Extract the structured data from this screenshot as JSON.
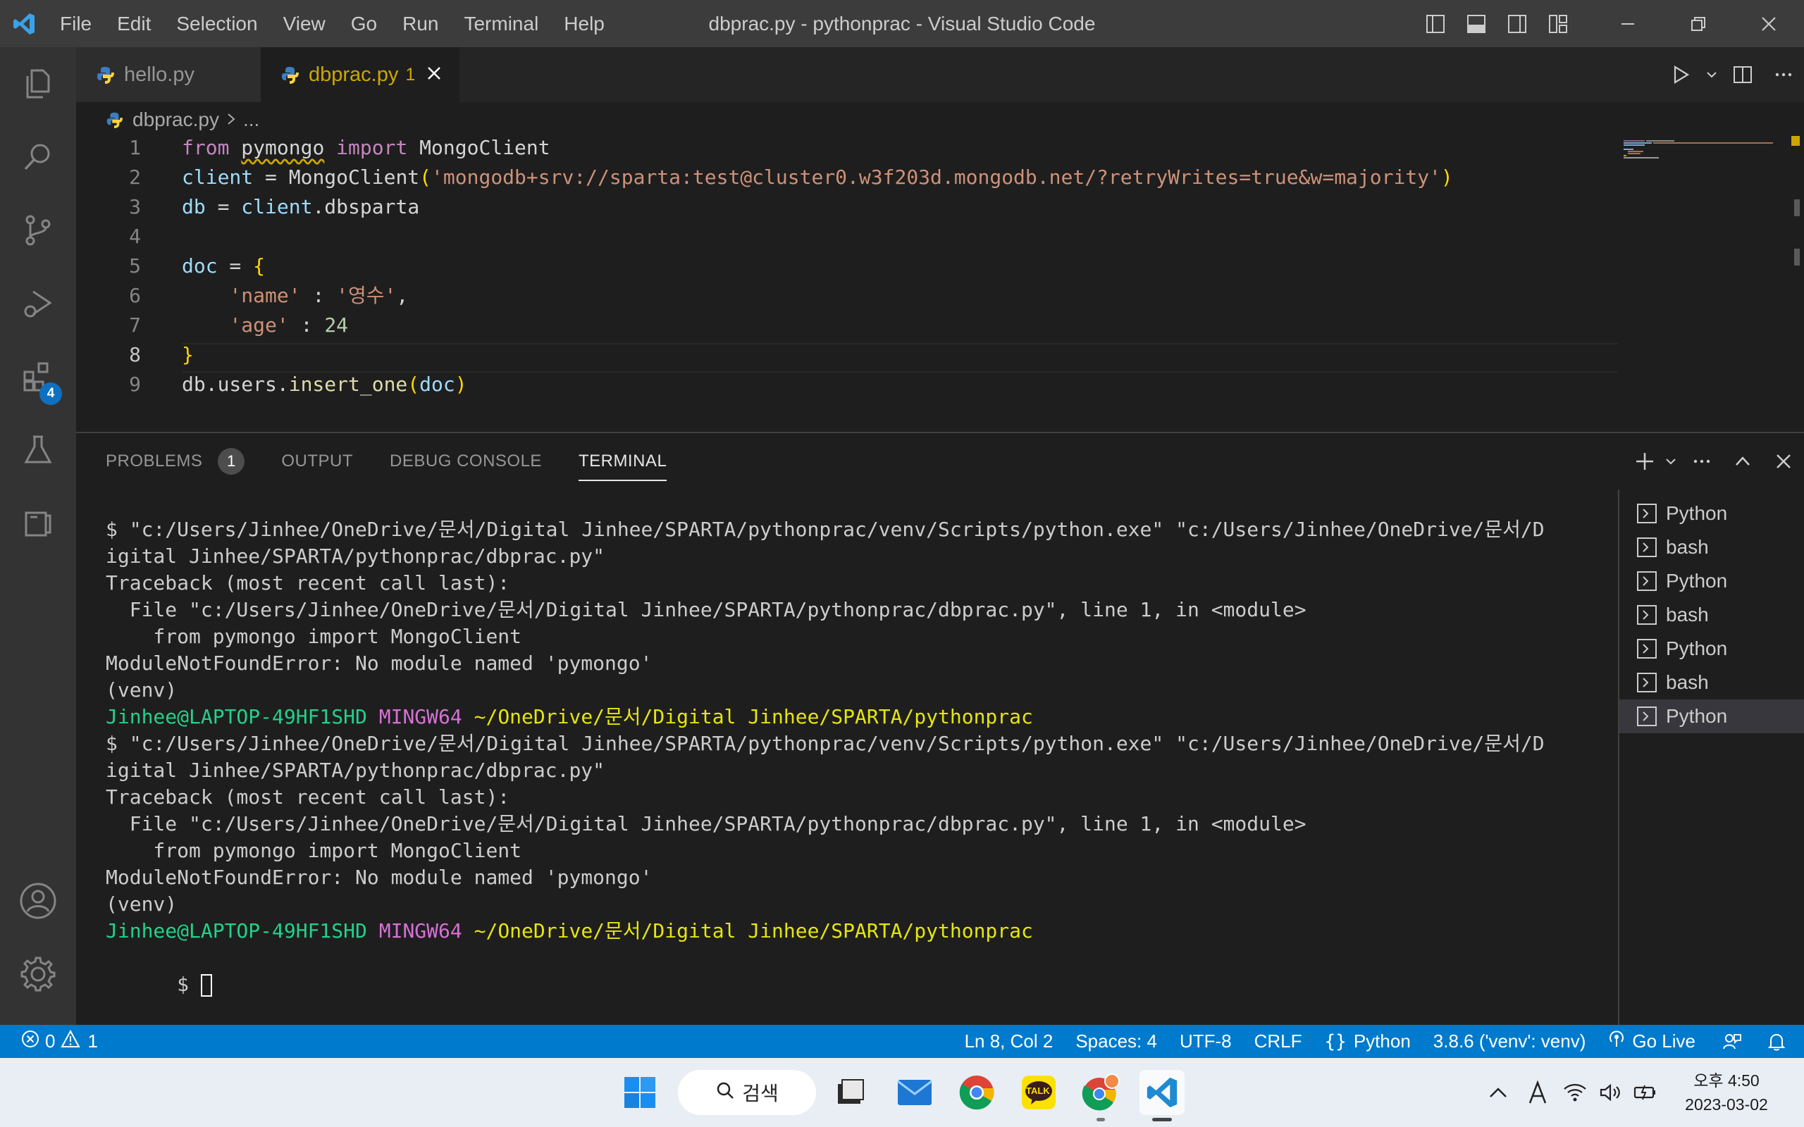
{
  "window": {
    "title": "dbprac.py - pythonprac - Visual Studio Code"
  },
  "menu": [
    "File",
    "Edit",
    "Selection",
    "View",
    "Go",
    "Run",
    "Terminal",
    "Help"
  ],
  "activity_bar": {
    "items": [
      "explorer-icon",
      "search-icon",
      "source-control-icon",
      "run-debug-icon",
      "extensions-icon",
      "testing-icon",
      "remote-explorer-icon"
    ],
    "extensions_badge": "4",
    "bottom": [
      "account-icon",
      "gear-icon"
    ]
  },
  "tabs": [
    {
      "label": "hello.py",
      "active": false
    },
    {
      "label": "dbprac.py",
      "active": true,
      "problems": "1"
    }
  ],
  "breadcrumb": {
    "file": "dbprac.py",
    "rest": "..."
  },
  "editor": {
    "active_line": 8,
    "lines": [
      {
        "n": "1",
        "tokens": [
          [
            "kw",
            "from"
          ],
          [
            "op",
            " "
          ],
          [
            "mod",
            "pymongo"
          ],
          [
            "op",
            " "
          ],
          [
            "kw",
            "import"
          ],
          [
            "op",
            " MongoClient"
          ]
        ]
      },
      {
        "n": "2",
        "tokens": [
          [
            "var",
            "client"
          ],
          [
            "op",
            " = "
          ],
          [
            "op",
            "MongoClient"
          ],
          [
            "brace",
            "("
          ],
          [
            "str",
            "'mongodb+srv://sparta:test@cluster0.w3f203d.mongodb.net/?retryWrites=true&w=majority'"
          ],
          [
            "brace",
            ")"
          ]
        ]
      },
      {
        "n": "3",
        "tokens": [
          [
            "var",
            "db"
          ],
          [
            "op",
            " = "
          ],
          [
            "var",
            "client"
          ],
          [
            "op",
            ".dbsparta"
          ]
        ]
      },
      {
        "n": "4",
        "tokens": []
      },
      {
        "n": "5",
        "tokens": [
          [
            "var",
            "doc"
          ],
          [
            "op",
            " = "
          ],
          [
            "brace",
            "{"
          ]
        ]
      },
      {
        "n": "6",
        "tokens": [
          [
            "op",
            "    "
          ],
          [
            "str",
            "'name'"
          ],
          [
            "op",
            " : "
          ],
          [
            "str",
            "'영수'"
          ],
          [
            "op",
            ","
          ]
        ]
      },
      {
        "n": "7",
        "tokens": [
          [
            "op",
            "    "
          ],
          [
            "str",
            "'age'"
          ],
          [
            "op",
            " : "
          ],
          [
            "num",
            "24"
          ]
        ]
      },
      {
        "n": "8",
        "tokens": [
          [
            "brace",
            "}"
          ]
        ]
      },
      {
        "n": "9",
        "tokens": [
          [
            "op",
            "db.users."
          ],
          [
            "fn",
            "insert_one"
          ],
          [
            "brace",
            "("
          ],
          [
            "var",
            "doc"
          ],
          [
            "brace",
            ")"
          ]
        ]
      }
    ]
  },
  "panel": {
    "tabs": [
      {
        "label": "PROBLEMS",
        "count": "1"
      },
      {
        "label": "OUTPUT"
      },
      {
        "label": "DEBUG CONSOLE"
      },
      {
        "label": "TERMINAL",
        "active": true
      }
    ],
    "terminal_lines": [
      [
        [
          "",
          "$ \"c:/Users/Jinhee/OneDrive/문서/Digital Jinhee/SPARTA/pythonprac/venv/Scripts/python.exe\" \"c:/Users/Jinhee/OneDrive/문서/D"
        ]
      ],
      [
        [
          "",
          "igital Jinhee/SPARTA/pythonprac/dbprac.py\""
        ]
      ],
      [
        [
          "",
          "Traceback (most recent call last):"
        ]
      ],
      [
        [
          "",
          "  File \"c:/Users/Jinhee/OneDrive/문서/Digital Jinhee/SPARTA/pythonprac/dbprac.py\", line 1, in <module>"
        ]
      ],
      [
        [
          "",
          "    from pymongo import MongoClient"
        ]
      ],
      [
        [
          "",
          "ModuleNotFoundError: No module named 'pymongo'"
        ]
      ],
      [
        [
          "",
          "(venv)"
        ]
      ],
      [
        [
          "green",
          "Jinhee@LAPTOP-49HF1SHD"
        ],
        [
          "",
          " "
        ],
        [
          "magenta",
          "MINGW64"
        ],
        [
          "",
          " "
        ],
        [
          "yellow",
          "~/OneDrive/문서/Digital Jinhee/SPARTA/pythonprac"
        ]
      ],
      [
        [
          "",
          "$ \"c:/Users/Jinhee/OneDrive/문서/Digital Jinhee/SPARTA/pythonprac/venv/Scripts/python.exe\" \"c:/Users/Jinhee/OneDrive/문서/D"
        ]
      ],
      [
        [
          "",
          "igital Jinhee/SPARTA/pythonprac/dbprac.py\""
        ]
      ],
      [
        [
          "",
          "Traceback (most recent call last):"
        ]
      ],
      [
        [
          "",
          "  File \"c:/Users/Jinhee/OneDrive/문서/Digital Jinhee/SPARTA/pythonprac/dbprac.py\", line 1, in <module>"
        ]
      ],
      [
        [
          "",
          "    from pymongo import MongoClient"
        ]
      ],
      [
        [
          "",
          "ModuleNotFoundError: No module named 'pymongo'"
        ]
      ],
      [
        [
          "",
          "(venv)"
        ]
      ],
      [
        [
          "green",
          "Jinhee@LAPTOP-49HF1SHD"
        ],
        [
          "",
          " "
        ],
        [
          "magenta",
          "MINGW64"
        ],
        [
          "",
          " "
        ],
        [
          "yellow",
          "~/OneDrive/문서/Digital Jinhee/SPARTA/pythonprac"
        ]
      ]
    ],
    "prompt": "$ ",
    "terminal_instances": [
      "Python",
      "bash",
      "Python",
      "bash",
      "Python",
      "bash",
      "Python"
    ],
    "selected_instance": 6
  },
  "statusbar": {
    "errors": "0",
    "warnings": "1",
    "position": "Ln 8, Col 2",
    "spaces": "Spaces: 4",
    "encoding": "UTF-8",
    "eol": "CRLF",
    "language": "Python",
    "interpreter": "3.8.6 ('venv': venv)",
    "golive": "Go Live"
  },
  "taskbar": {
    "search_label": "검색",
    "apps": [
      "windows-start-icon",
      "file-explorer-icon",
      "mail-icon",
      "chrome-icon",
      "kakaotalk-icon",
      "chrome-profile-icon",
      "vscode-icon"
    ],
    "kakaotalk_label": "TALK",
    "clock_time": "오후 4:50",
    "clock_date": "2023-03-02"
  },
  "colors": {
    "accent": "#007acc",
    "titlebar": "#3c3c3c",
    "activitybar": "#333333",
    "editor_bg": "#1e1e1e",
    "warning": "#cca700"
  }
}
